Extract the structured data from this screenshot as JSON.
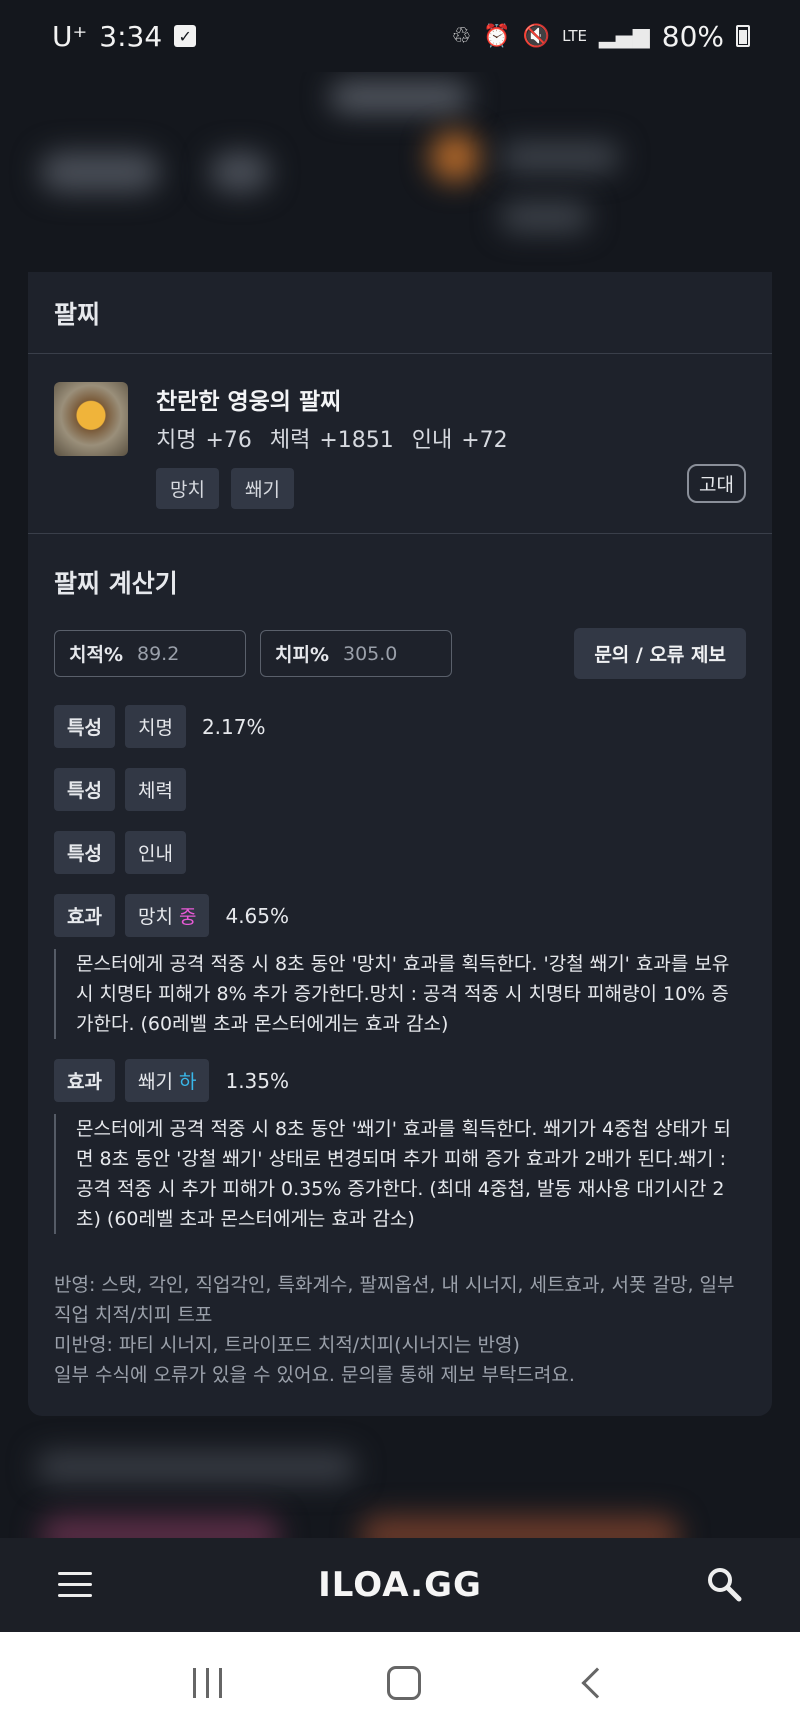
{
  "status_bar": {
    "carrier": "U⁺",
    "time": "3:34",
    "network": "LTE",
    "battery": "80%"
  },
  "modal": {
    "title": "팔찌",
    "item": {
      "name": "찬란한 영웅의 팔찌",
      "stats": "치명 +76  체력 +1851  인내 +72",
      "grade": "고대",
      "tags": [
        "망치",
        "쐐기"
      ]
    },
    "calculator": {
      "title": "팔찌 계산기",
      "crit_rate": {
        "label": "치적%",
        "value": "89.2"
      },
      "crit_damage": {
        "label": "치피%",
        "value": "305.0"
      },
      "report_button": "문의 / 오류 제보",
      "options": [
        {
          "kind": "특성",
          "name": "치명",
          "value": "2.17%"
        },
        {
          "kind": "특성",
          "name": "체력",
          "value": ""
        },
        {
          "kind": "특성",
          "name": "인내",
          "value": ""
        }
      ],
      "effects": [
        {
          "kind": "효과",
          "name": "망치",
          "level": "중",
          "value": "4.65%",
          "description": "몬스터에게 공격 적중 시 8초 동안 '망치' 효과를 획득한다. '강철 쐐기' 효과를 보유 시 치명타 피해가 8% 추가 증가한다.망치 : 공격 적중 시 치명타 피해량이 10% 증가한다. (60레벨 초과 몬스터에게는 효과 감소)"
        },
        {
          "kind": "효과",
          "name": "쐐기",
          "level": "하",
          "value": "1.35%",
          "description": "몬스터에게 공격 적중 시 8초 동안 '쐐기' 효과를 획득한다. 쐐기가 4중첩 상태가 되면 8초 동안 '강철 쐐기' 상태로 변경되며 추가 피해 증가 효과가 2배가 된다.쐐기 : 공격 적중 시 추가 피해가 0.35% 증가한다. (최대 4중첩, 발동 재사용 대기시간 2초) (60레벨 초과 몬스터에게는 효과 감소)"
        }
      ],
      "notes": [
        "반영: 스탯, 각인, 직업각인, 특화계수, 팔찌옵션, 내 시너지, 세트효과, 서폿 갈망, 일부 직업 치적/치피 트포",
        "미반영: 파티 시너지, 트라이포드 치적/치피(시너지는 반영)",
        "일부 수식에 오류가 있을 수 있어요. 문의를 통해 제보 부탁드려요."
      ]
    }
  },
  "app_bar": {
    "logo": "ILOA.GG"
  },
  "colors": {
    "mid_level": "#e85ad6",
    "low_level": "#39b8ea",
    "modal_bg": "#1e222b"
  }
}
